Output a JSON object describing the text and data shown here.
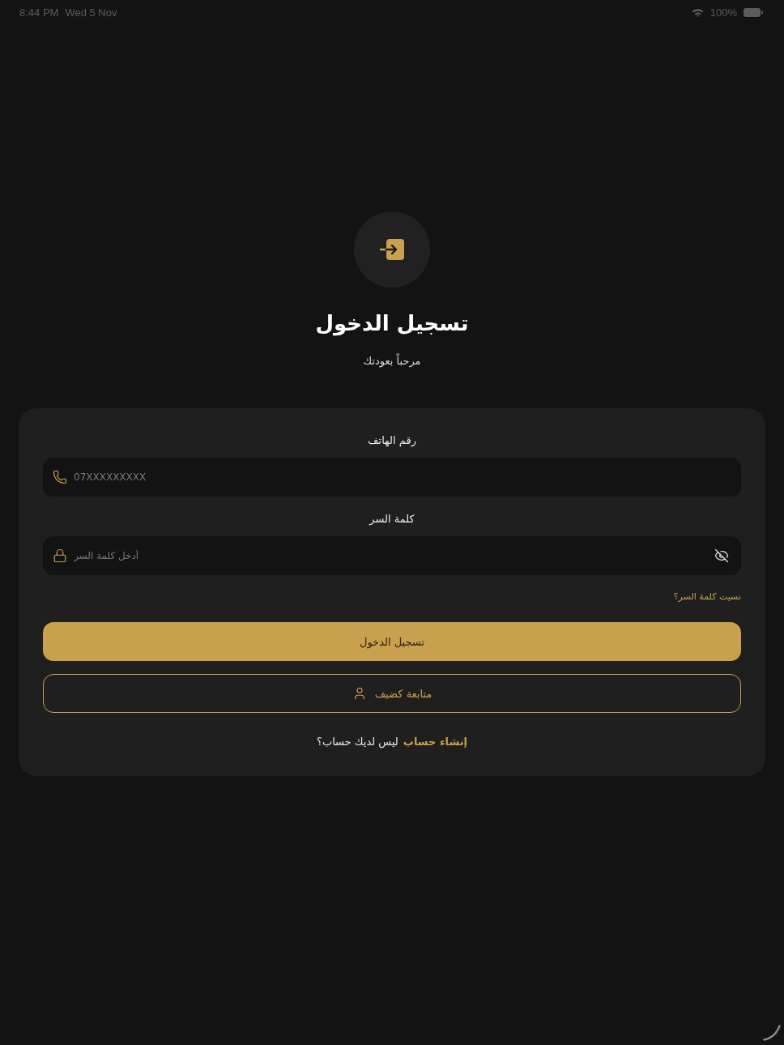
{
  "status_bar": {
    "time": "8:44 PM",
    "date": "Wed 5 Nov",
    "battery": "100%"
  },
  "header": {
    "title": "تسجيل الدخول",
    "subtitle": "مرحباً بعودتك"
  },
  "form": {
    "fields": [
      {
        "kind": "phone",
        "label": "رقم الهاتف",
        "placeholder": "07XXXXXXXXX"
      },
      {
        "kind": "password",
        "label": "كلمة السر",
        "placeholder": "أدخل كلمة السر",
        "password_hidden": true
      }
    ],
    "forgot_link": "نسيت كلمة السر؟",
    "buttons": [
      {
        "kind": "primary",
        "label": "تسجيل الدخول"
      },
      {
        "kind": "outline",
        "label": "متابعة كضيف"
      }
    ],
    "footer": {
      "link": "إنشاء حساب",
      "prompt": "ليس لديك حساب؟"
    }
  }
}
